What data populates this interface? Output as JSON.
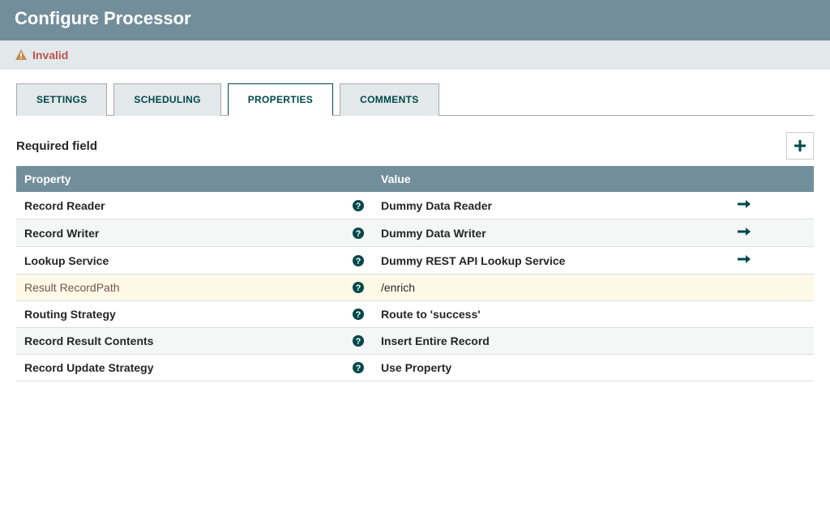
{
  "header": {
    "title": "Configure Processor"
  },
  "status": {
    "text": "Invalid"
  },
  "tabs": {
    "settings": "SETTINGS",
    "scheduling": "SCHEDULING",
    "properties": "PROPERTIES",
    "comments": "COMMENTS"
  },
  "section": {
    "required_label": "Required field"
  },
  "columns": {
    "property": "Property",
    "value": "Value"
  },
  "rows": [
    {
      "name": "Record Reader",
      "value": "Dummy Data Reader",
      "goto": true,
      "bold": true
    },
    {
      "name": "Record Writer",
      "value": "Dummy Data Writer",
      "goto": true,
      "bold": true
    },
    {
      "name": "Lookup Service",
      "value": "Dummy REST API Lookup Service",
      "goto": true,
      "bold": true
    },
    {
      "name": "Result RecordPath",
      "value": "/enrich",
      "goto": false,
      "bold": false,
      "highlight": true
    },
    {
      "name": "Routing Strategy",
      "value": "Route to 'success'",
      "goto": false,
      "bold": true
    },
    {
      "name": "Record Result Contents",
      "value": "Insert Entire Record",
      "goto": false,
      "bold": true
    },
    {
      "name": "Record Update Strategy",
      "value": "Use Property",
      "goto": false,
      "bold": true
    }
  ]
}
